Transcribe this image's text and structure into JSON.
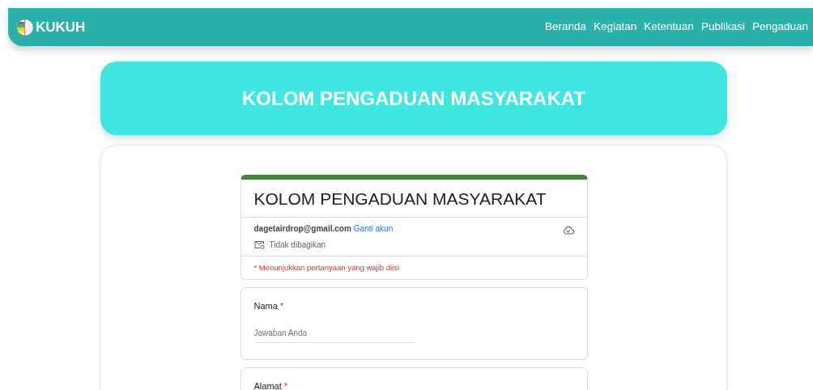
{
  "navbar": {
    "brand": "KUKUH",
    "items": [
      {
        "label": "Beranda"
      },
      {
        "label": "Kegiatan"
      },
      {
        "label": "Ketentuan"
      },
      {
        "label": "Publikasi"
      },
      {
        "label": "Pengaduan"
      }
    ]
  },
  "banner": {
    "title": "KOLOM PENGADUAN MASYARAKAT"
  },
  "form": {
    "title": "KOLOM PENGADUAN MASYARAKAT",
    "account": "dagetairdrop@gmail.com",
    "switch_account": "Ganti akun",
    "sharing": "Tidak dibagikan",
    "required_note": "* Menunjukkan pertanyaan yang wajib diisi",
    "required_mark": "*",
    "questions": [
      {
        "label": "Nama",
        "required": true,
        "placeholder": "Jawaban Anda"
      },
      {
        "label": "Alamat",
        "required": true
      }
    ]
  }
}
